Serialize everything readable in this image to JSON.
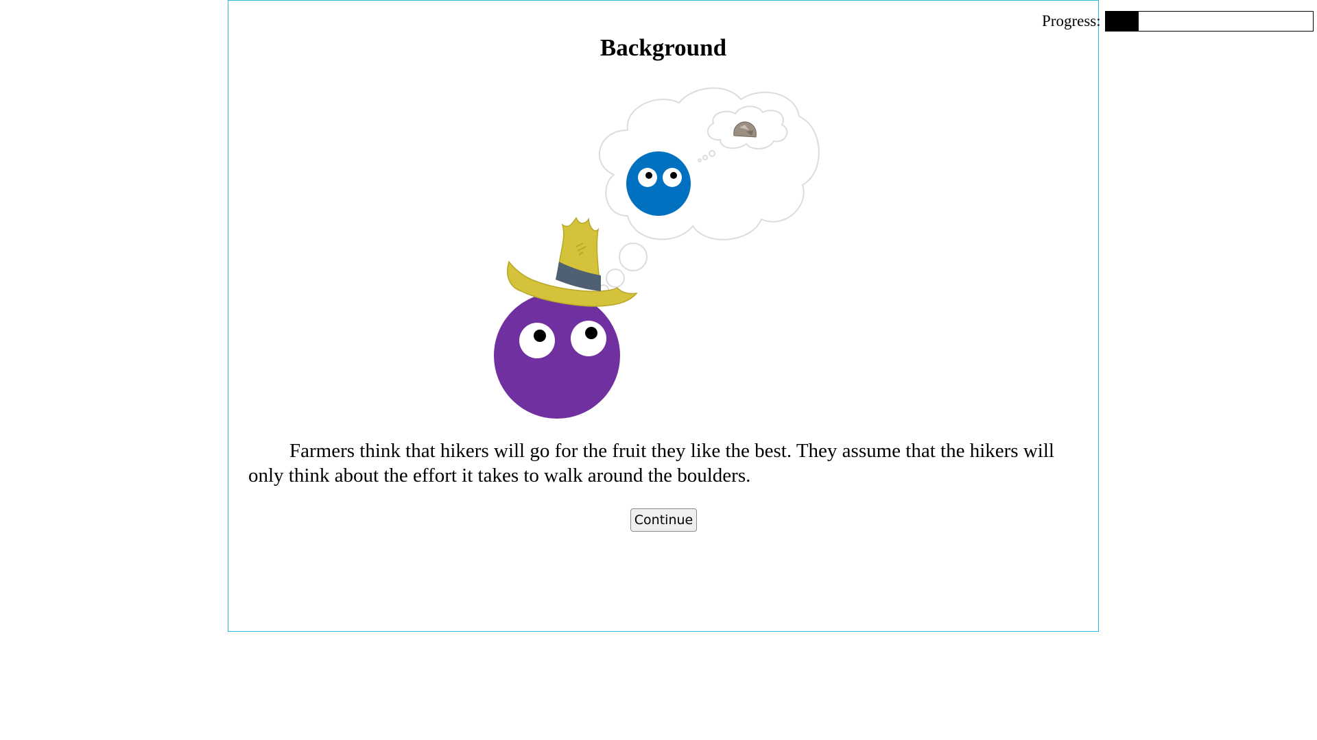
{
  "progress": {
    "label": "Progress:",
    "fraction": 0.16
  },
  "page": {
    "title": "Background"
  },
  "story": {
    "text": "Farmers think that hikers will go for the fruit they like the best. They assume that the hikers will only think about the effort it takes to walk around the boulders."
  },
  "actions": {
    "continue_label": "Continue"
  },
  "colors": {
    "frame_border": "#29b6d9",
    "farmer_body": "#7030a0",
    "hiker_body": "#0070c0",
    "hat": "#d4c23a",
    "hat_band": "#4f6072",
    "progress_fill": "#000000"
  },
  "illustration": {
    "farmer_icon": "purple-farmer-with-straw-hat",
    "hiker_icon": "blue-hiker-character",
    "thought_icon": "thought-bubble",
    "boulder_icon": "boulder-rock"
  }
}
